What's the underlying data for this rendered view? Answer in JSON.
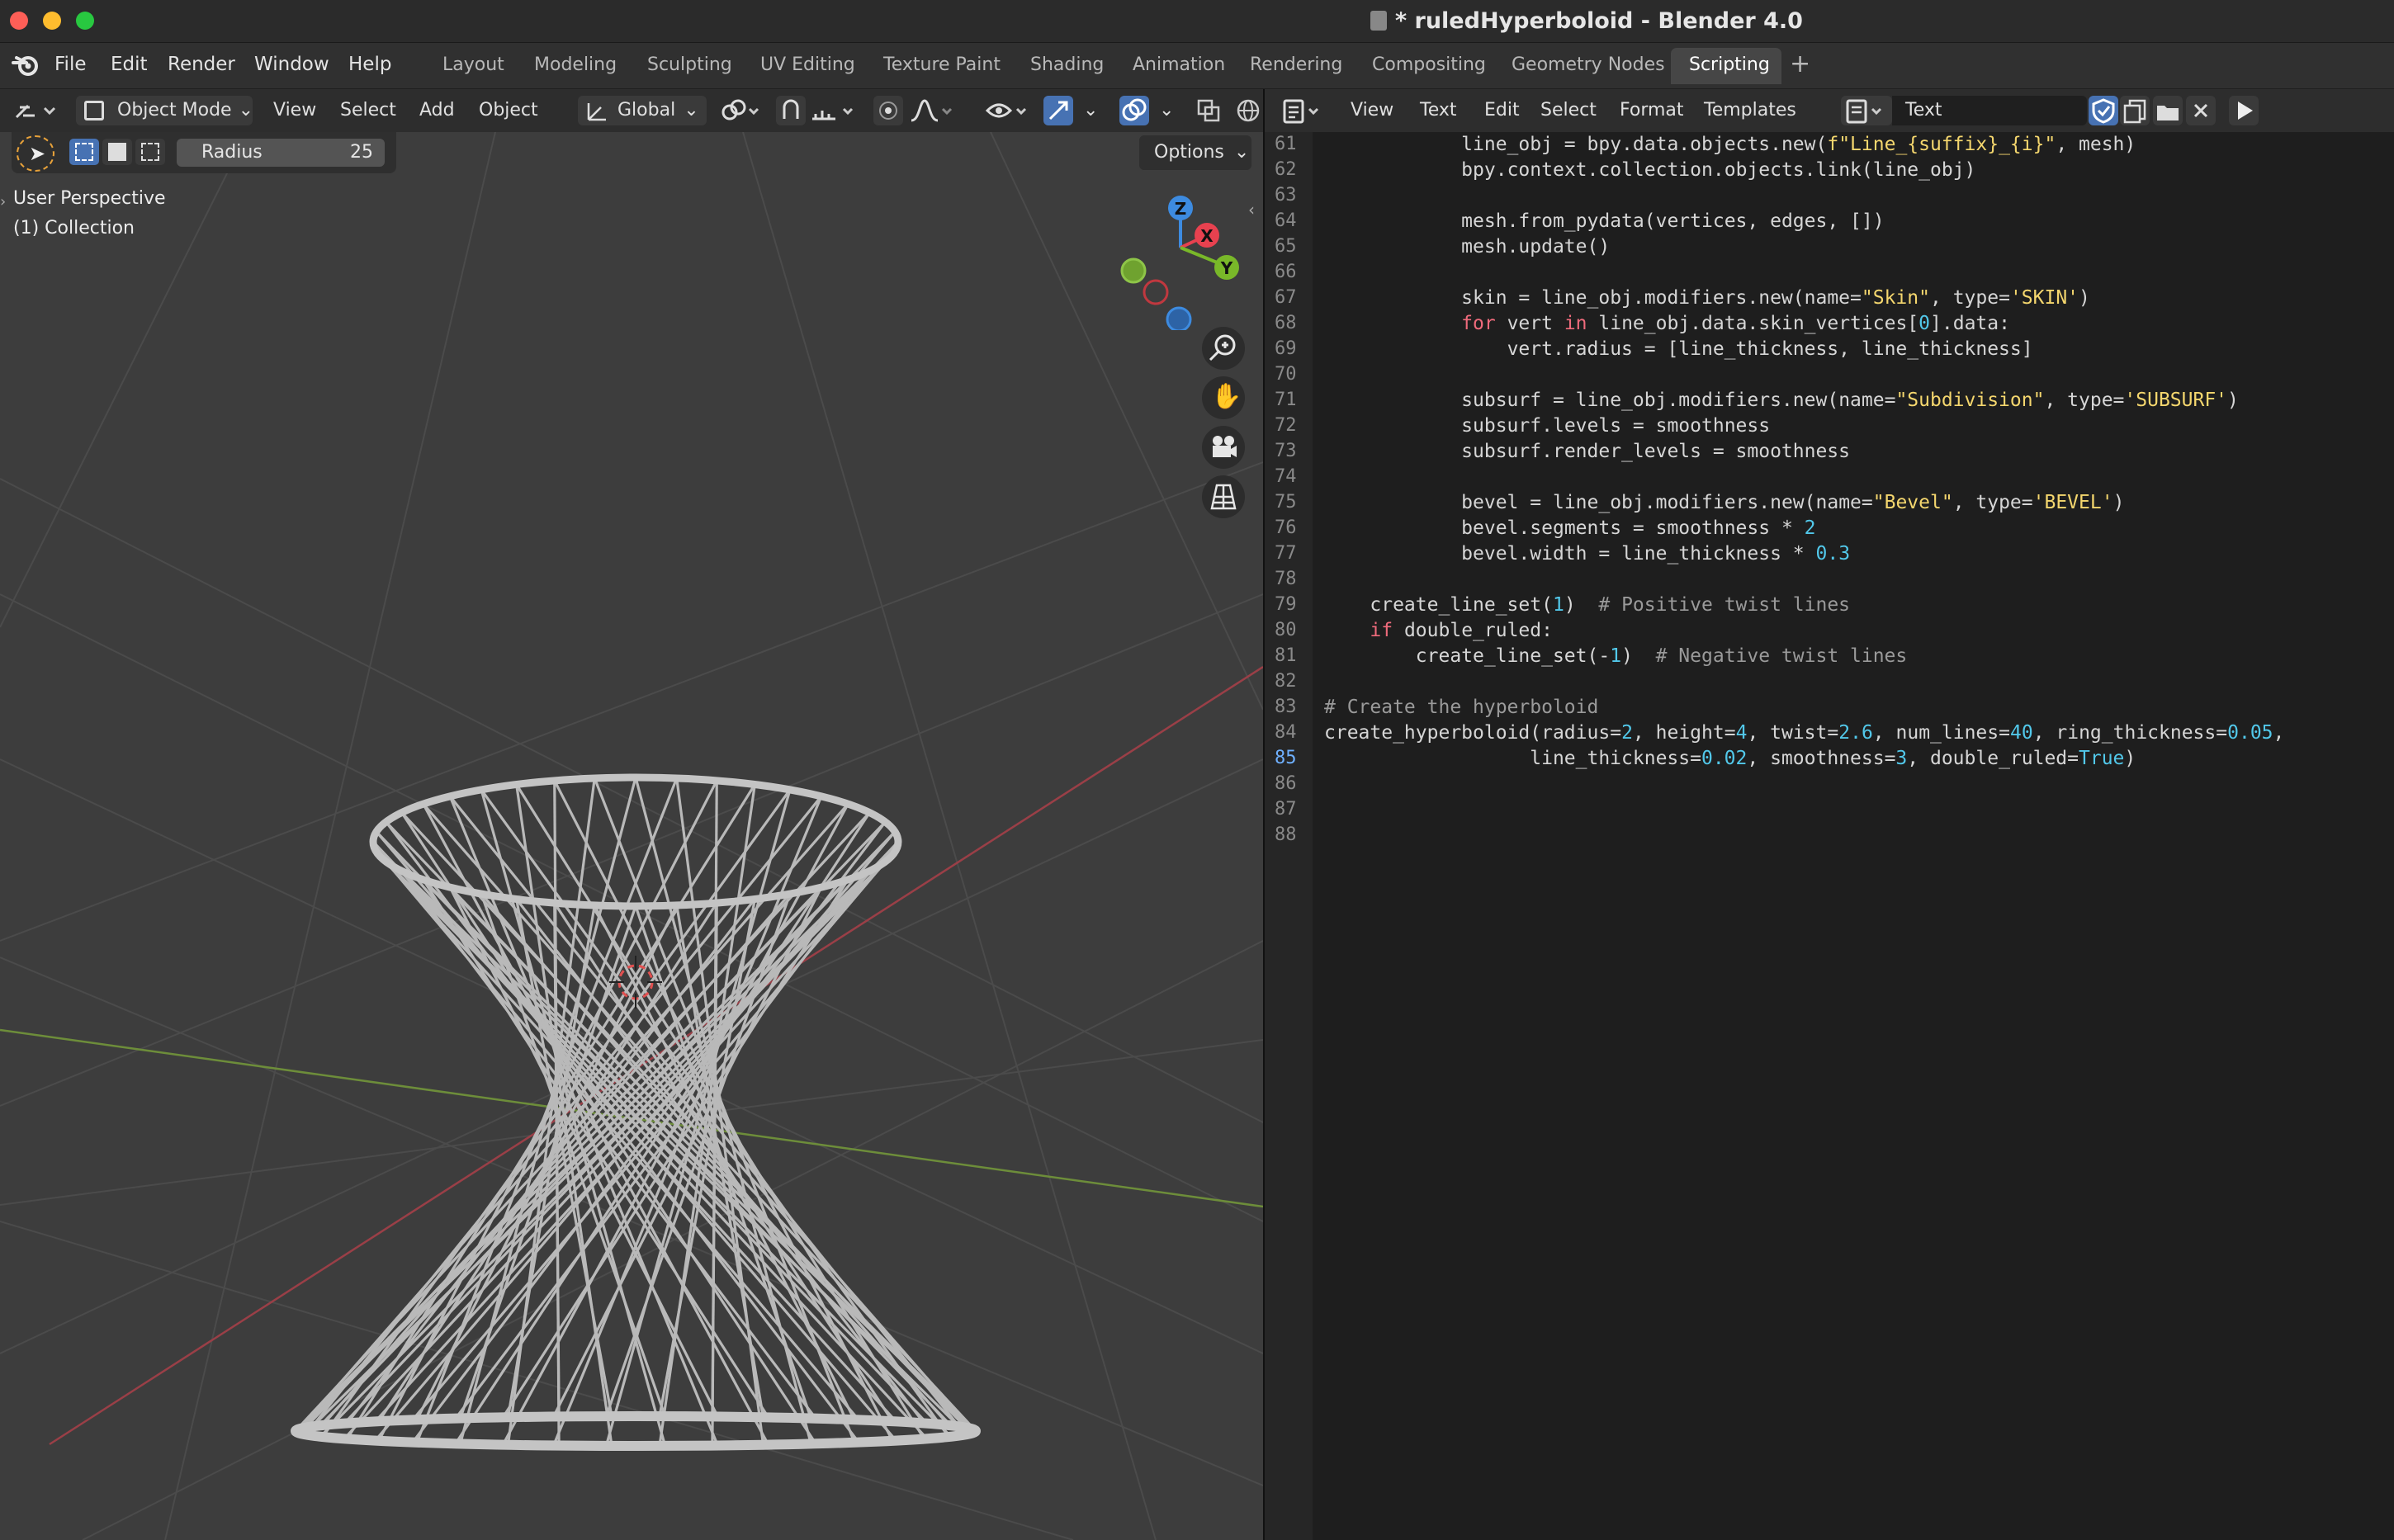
{
  "window": {
    "title": "* ruledHyperboloid - Blender 4.0"
  },
  "menus": [
    "File",
    "Edit",
    "Render",
    "Window",
    "Help"
  ],
  "workspaces": [
    "Layout",
    "Modeling",
    "Sculpting",
    "UV Editing",
    "Texture Paint",
    "Shading",
    "Animation",
    "Rendering",
    "Compositing",
    "Geometry Nodes",
    "Scripting"
  ],
  "active_workspace": "Scripting",
  "viewport": {
    "mode": "Object Mode",
    "menus": [
      "View",
      "Select",
      "Add",
      "Object"
    ],
    "orientation": "Global",
    "radius_label": "Radius",
    "radius_value": "25",
    "options_label": "Options",
    "perspective": "User Perspective",
    "collection": "(1) Collection",
    "gizmo": {
      "x": "X",
      "y": "Y",
      "z": "Z"
    }
  },
  "text_editor": {
    "menus": [
      "View",
      "Text",
      "Edit",
      "Select",
      "Format",
      "Templates"
    ],
    "datablock_name": "Text",
    "current_line": "85",
    "lines": [
      {
        "no": "61",
        "code": "            line_obj = bpy.data.objects.new(f\"Line_{suffix}_{i}\", mesh)"
      },
      {
        "no": "62",
        "code": "            bpy.context.collection.objects.link(line_obj)"
      },
      {
        "no": "63",
        "code": ""
      },
      {
        "no": "64",
        "code": "            mesh.from_pydata(vertices, edges, [])"
      },
      {
        "no": "65",
        "code": "            mesh.update()"
      },
      {
        "no": "66",
        "code": ""
      },
      {
        "no": "67",
        "code": "            skin = line_obj.modifiers.new(name=\"Skin\", type='SKIN')"
      },
      {
        "no": "68",
        "code": "            for vert in line_obj.data.skin_vertices[0].data:"
      },
      {
        "no": "69",
        "code": "                vert.radius = [line_thickness, line_thickness]"
      },
      {
        "no": "70",
        "code": ""
      },
      {
        "no": "71",
        "code": "            subsurf = line_obj.modifiers.new(name=\"Subdivision\", type='SUBSURF')"
      },
      {
        "no": "72",
        "code": "            subsurf.levels = smoothness"
      },
      {
        "no": "73",
        "code": "            subsurf.render_levels = smoothness"
      },
      {
        "no": "74",
        "code": ""
      },
      {
        "no": "75",
        "code": "            bevel = line_obj.modifiers.new(name=\"Bevel\", type='BEVEL')"
      },
      {
        "no": "76",
        "code": "            bevel.segments = smoothness * 2"
      },
      {
        "no": "77",
        "code": "            bevel.width = line_thickness * 0.3"
      },
      {
        "no": "78",
        "code": ""
      },
      {
        "no": "79",
        "code": "    create_line_set(1)  # Positive twist lines"
      },
      {
        "no": "80",
        "code": "    if double_ruled:"
      },
      {
        "no": "81",
        "code": "        create_line_set(-1)  # Negative twist lines"
      },
      {
        "no": "82",
        "code": ""
      },
      {
        "no": "83",
        "code": "# Create the hyperboloid"
      },
      {
        "no": "84",
        "code": "create_hyperboloid(radius=2, height=4, twist=2.6, num_lines=40, ring_thickness=0.05,"
      },
      {
        "no": "85",
        "code": "                  line_thickness=0.02, smoothness=3, double_ruled=True)"
      },
      {
        "no": "86",
        "code": ""
      },
      {
        "no": "87",
        "code": ""
      },
      {
        "no": "88",
        "code": ""
      }
    ]
  },
  "colors": {
    "keyword": "#ef6b7c",
    "string": "#f5d76e",
    "number": "#52c8ea",
    "comment": "#9a9a9a",
    "x_axis": "#e8414f",
    "y_axis": "#79b829",
    "z_axis": "#3d8be0"
  }
}
